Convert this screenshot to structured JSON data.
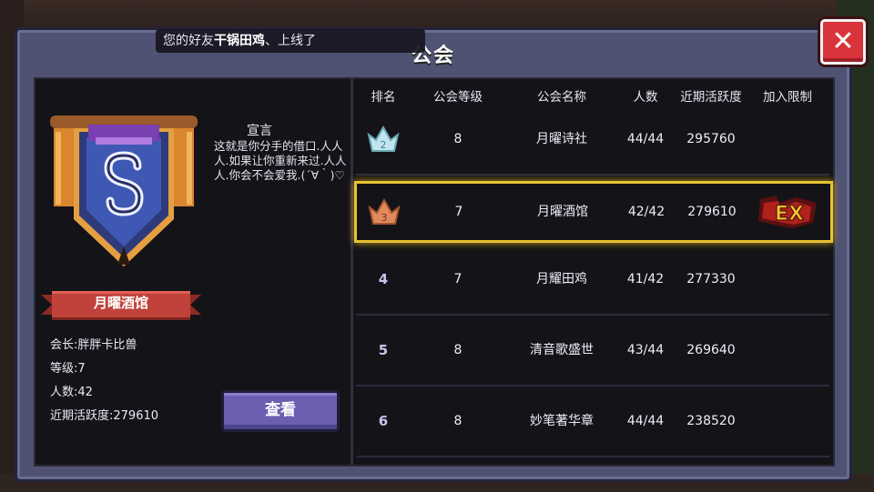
{
  "title": "公会",
  "toast": {
    "prefix": "您的好友",
    "friend": "干锅田鸡",
    "suffix": "、上线了"
  },
  "guild": {
    "name": "月曜酒馆",
    "declaration_title": "宣言",
    "declaration": "这就是你分手的借口.人人人.如果让你重新来过.人人人.你会不会爱我.(´∀｀)♡",
    "leader_label": "会长:",
    "leader": "胖胖卡比兽",
    "level_label": "等级:",
    "level": "7",
    "members_label": "人数:",
    "members": "42",
    "activity_label": "近期活跃度:",
    "activity": "279610",
    "view_button": "查看",
    "colors": {
      "banner": "#d9862e",
      "shield": "#2f3a7a",
      "ribbon": "#c0423a"
    }
  },
  "table": {
    "headers": [
      "排名",
      "公会等级",
      "公会名称",
      "人数",
      "近期活跃度",
      "加入限制"
    ],
    "rows": [
      {
        "rank": "2",
        "rank_icon": "silver-crown-icon",
        "level": "8",
        "name": "月曜诗社",
        "members": "44/44",
        "activity": "295760",
        "limit": ""
      },
      {
        "rank": "3",
        "rank_icon": "bronze-crown-icon",
        "level": "7",
        "name": "月曜酒馆",
        "members": "42/42",
        "activity": "279610",
        "limit": "ex-badge-icon",
        "highlight": true
      },
      {
        "rank": "4",
        "rank_icon": "",
        "level": "7",
        "name": "月耀田鸡",
        "members": "41/42",
        "activity": "277330",
        "limit": ""
      },
      {
        "rank": "5",
        "rank_icon": "",
        "level": "8",
        "name": "清音歌盛世",
        "members": "43/44",
        "activity": "269640",
        "limit": ""
      },
      {
        "rank": "6",
        "rank_icon": "",
        "level": "8",
        "name": "妙笔著华章",
        "members": "44/44",
        "activity": "238520",
        "limit": ""
      }
    ],
    "highlight_color": "#e8c235"
  }
}
